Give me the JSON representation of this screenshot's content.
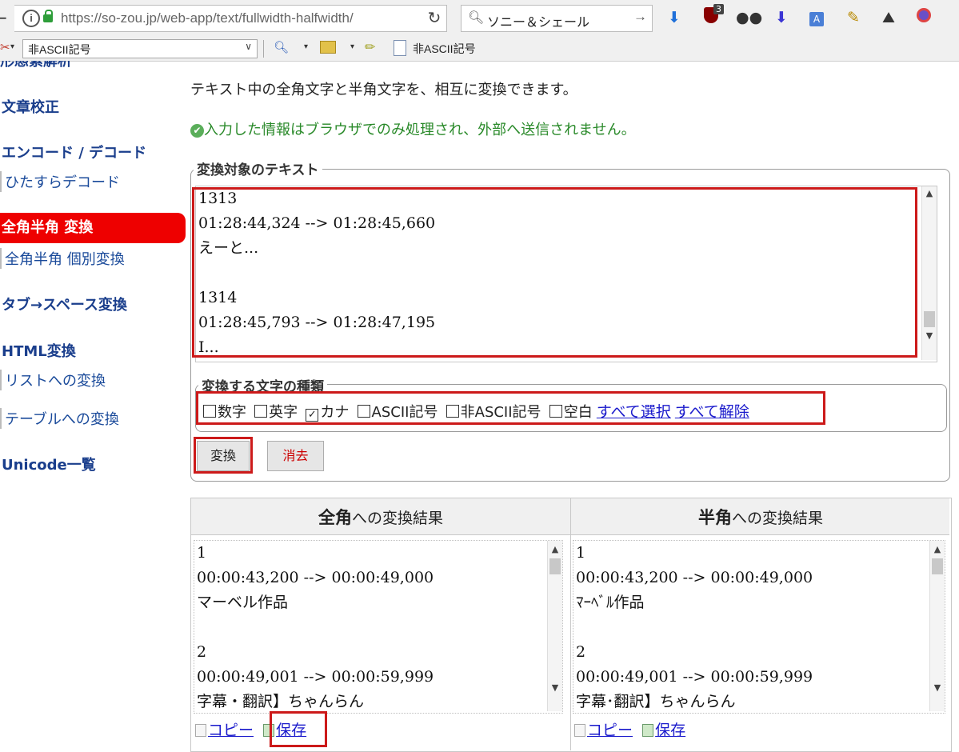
{
  "browser": {
    "url": "https://so-zou.jp/web-app/text/fullwidth-halfwidth/",
    "search_query": "ソニー＆シェール",
    "toolbar_dropdown_value": "非ASCII記号",
    "bookmark_label": "非ASCII記号",
    "addon_badge": "3"
  },
  "sidebar": {
    "cut_top": "形態素解析",
    "items": [
      {
        "label": "文章校正"
      },
      {
        "label": "エンコード / デコード"
      },
      {
        "label": "ひたすらデコード"
      },
      {
        "label": "全角半角 変換"
      },
      {
        "label": "全角半角 個別変換"
      },
      {
        "label": "タブ→スペース変換"
      },
      {
        "label": "HTML変換"
      },
      {
        "label": "リストへの変換"
      },
      {
        "label": "テーブルへの変換"
      },
      {
        "label": "Unicode一覧"
      }
    ]
  },
  "main": {
    "description": "テキスト中の全角文字と半角文字を、相互に変換できます。",
    "privacy_note": "入力した情報はブラウザでのみ処理され、外部へ送信されません。",
    "input_legend": "変換対象のテキスト",
    "input_text": "1313\n01:28:44,324 --> 01:28:45,660\nえーと...\n\n1314\n01:28:45,793 --> 01:28:47,195\nI...",
    "options_legend": "変換する文字の種類",
    "options": [
      {
        "label": "数字",
        "checked": false
      },
      {
        "label": "英字",
        "checked": false
      },
      {
        "label": "カナ",
        "checked": true
      },
      {
        "label": "ASCII記号",
        "checked": false
      },
      {
        "label": "非ASCII記号",
        "checked": false
      },
      {
        "label": "空白",
        "checked": false
      }
    ],
    "select_all": "すべて選択",
    "deselect_all": "すべて解除",
    "convert_button": "変換",
    "clear_button": "消去",
    "results": [
      {
        "bold": "全角",
        "rest": "への変換結果",
        "text": "1\n00:00:43,200 --> 00:00:49,000\nマーベル作品\n\n2\n00:00:49,001 --> 00:00:59,999\n字幕・翻訳】ちゃんらん",
        "copy": "コピー",
        "save": "保存"
      },
      {
        "bold": "半角",
        "rest": "への変換結果",
        "text": "1\n00:00:43,200 --> 00:00:49,000\nﾏｰﾍﾞﾙ作品\n\n2\n00:00:49,001 --> 00:00:59,999\n字幕･翻訳】ちゃんらん",
        "copy": "コピー",
        "save": "保存"
      }
    ]
  },
  "colors": {
    "active_nav_bg": "#ee0000",
    "nav_link": "#1a3e8c",
    "privacy_green": "#2a8a2a",
    "highlight_red": "#cc1a1a",
    "clear_button_text": "#cc0000"
  }
}
